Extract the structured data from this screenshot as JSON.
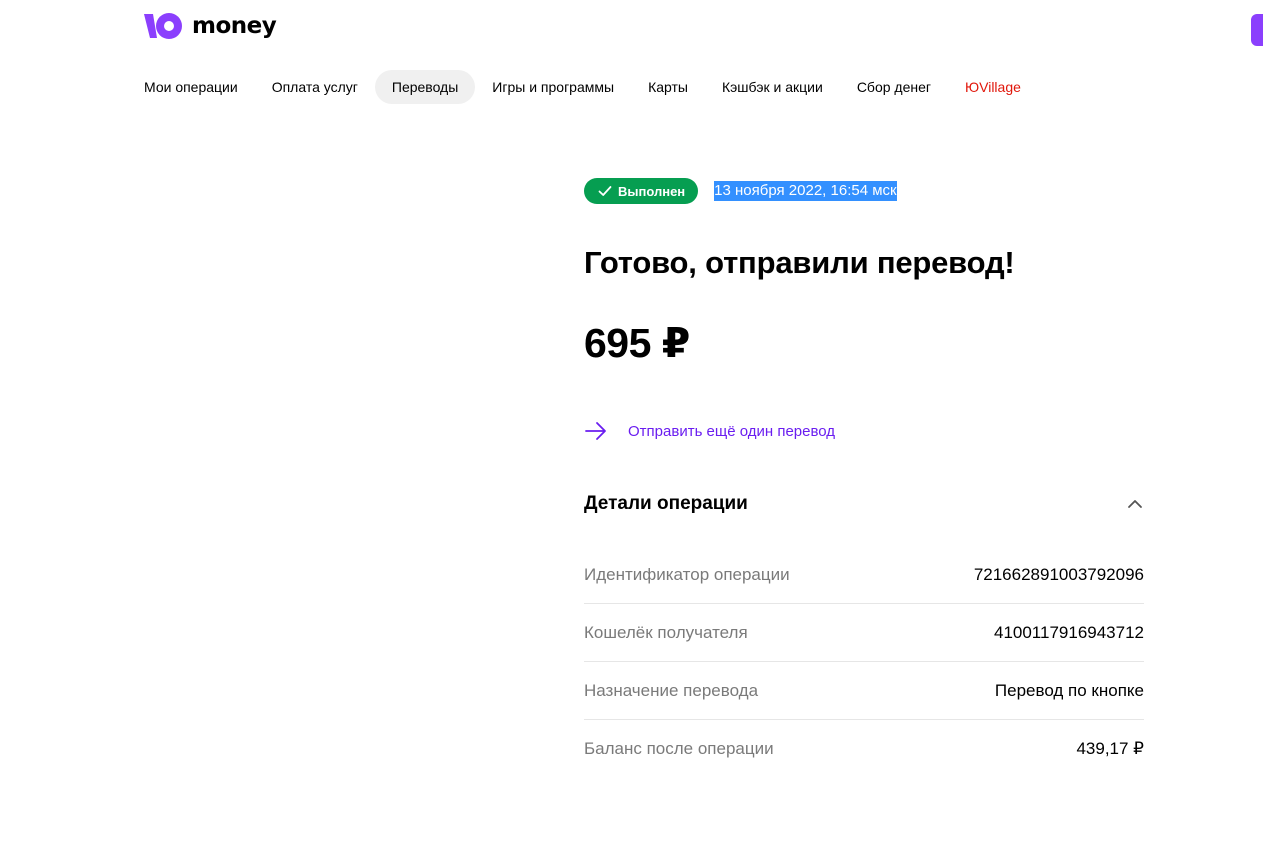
{
  "brand": {
    "name": "money",
    "accent_color": "#8b3ffd"
  },
  "nav": {
    "items": [
      {
        "label": "Мои операции",
        "active": false
      },
      {
        "label": "Оплата услуг",
        "active": false
      },
      {
        "label": "Переводы",
        "active": true
      },
      {
        "label": "Игры и программы",
        "active": false
      },
      {
        "label": "Карты",
        "active": false
      },
      {
        "label": "Кэшбэк и акции",
        "active": false
      },
      {
        "label": "Сбор денег",
        "active": false
      },
      {
        "label": "ЮVillage",
        "active": false
      }
    ]
  },
  "status": {
    "badge_label": "Выполнен",
    "badge_color": "#069e51",
    "badge_icon": "check-icon",
    "date": "13 ноября 2022, 16:54 мск"
  },
  "main": {
    "title": "Готово, отправили перевод!",
    "amount": "695 ₽",
    "send_again_label": "Отправить ещё один перевод",
    "send_again_icon": "arrow-right-icon"
  },
  "details": {
    "title": "Детали операции",
    "toggle_icon": "chevron-up-icon",
    "rows": [
      {
        "label": "Идентификатор операции",
        "value": "721662891003792096"
      },
      {
        "label": "Кошелёк получателя",
        "value": "4100117916943712"
      },
      {
        "label": "Назначение перевода",
        "value": "Перевод по кнопке"
      },
      {
        "label": "Баланс после операции",
        "value": "439,17 ₽"
      }
    ]
  }
}
